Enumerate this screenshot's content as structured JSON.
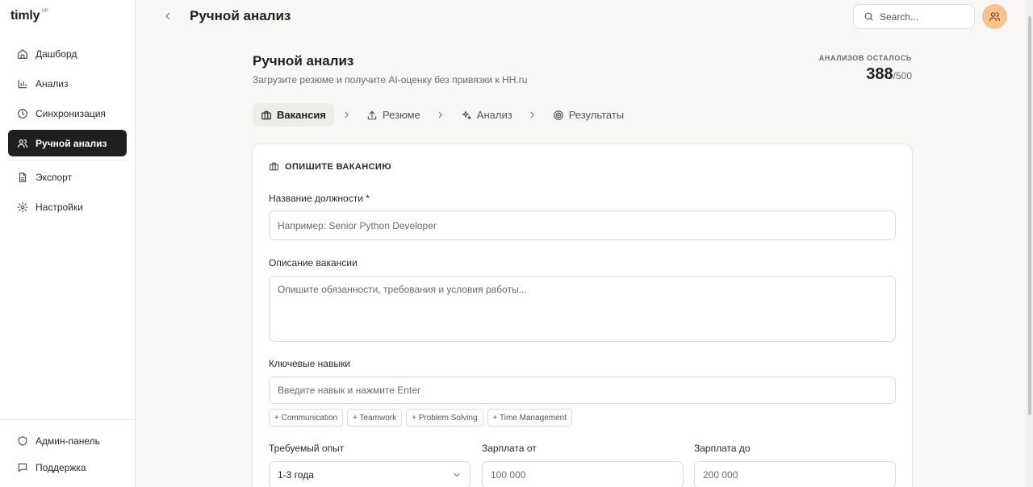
{
  "app": {
    "logo": "timly",
    "logo_sup": "HR"
  },
  "sidebar": {
    "items": [
      {
        "label": "Дашборд",
        "icon": "home-icon",
        "active": false
      },
      {
        "label": "Анализ",
        "icon": "bar-chart-icon",
        "active": false
      },
      {
        "label": "Синхронизация",
        "icon": "clock-icon",
        "active": false
      },
      {
        "label": "Ручной анализ",
        "icon": "users-icon",
        "active": true
      },
      {
        "label": "Экспорт",
        "icon": "file-icon",
        "active": false
      },
      {
        "label": "Настройки",
        "icon": "gear-icon",
        "active": false
      }
    ],
    "bottom": [
      {
        "label": "Админ-панель",
        "icon": "shield-icon"
      },
      {
        "label": "Поддержка",
        "icon": "chat-icon"
      }
    ]
  },
  "topbar": {
    "title": "Ручной анализ",
    "search_placeholder": "Search...",
    "avatar_icon": "users-icon"
  },
  "page": {
    "title": "Ручной анализ",
    "subtitle": "Загрузите резюме и получите AI-оценку без привязки к HH.ru",
    "quota_label": "АНАЛИЗОВ ОСТАЛОСЬ",
    "quota_remaining": "388",
    "quota_total": "/500"
  },
  "stepper": {
    "steps": [
      {
        "label": "Вакансия",
        "icon": "briefcase-icon",
        "active": true
      },
      {
        "label": "Резюме",
        "icon": "upload-icon",
        "active": false
      },
      {
        "label": "Анализ",
        "icon": "sparkles-icon",
        "active": false
      },
      {
        "label": "Результаты",
        "icon": "target-icon",
        "active": false
      }
    ]
  },
  "form": {
    "heading": "ОПИШИТЕ ВАКАНСИЮ",
    "job_title_label": "Название должности *",
    "job_title_placeholder": "Например: Senior Python Developer",
    "description_label": "Описание вакансии",
    "description_placeholder": "Опишите обязанности, требования и условия работы...",
    "skills_label": "Ключевые навыки",
    "skills_placeholder": "Введите навык и нажмите Enter",
    "skill_suggestions": [
      "+ Communication",
      "+ Teamwork",
      "+ Problem Solving",
      "+ Time Management"
    ],
    "experience_label": "Требуемый опыт",
    "experience_value": "1-3 года",
    "salary_from_label": "Зарплата от",
    "salary_from_placeholder": "100 000",
    "salary_to_label": "Зарплата до",
    "salary_to_placeholder": "200 000"
  }
}
